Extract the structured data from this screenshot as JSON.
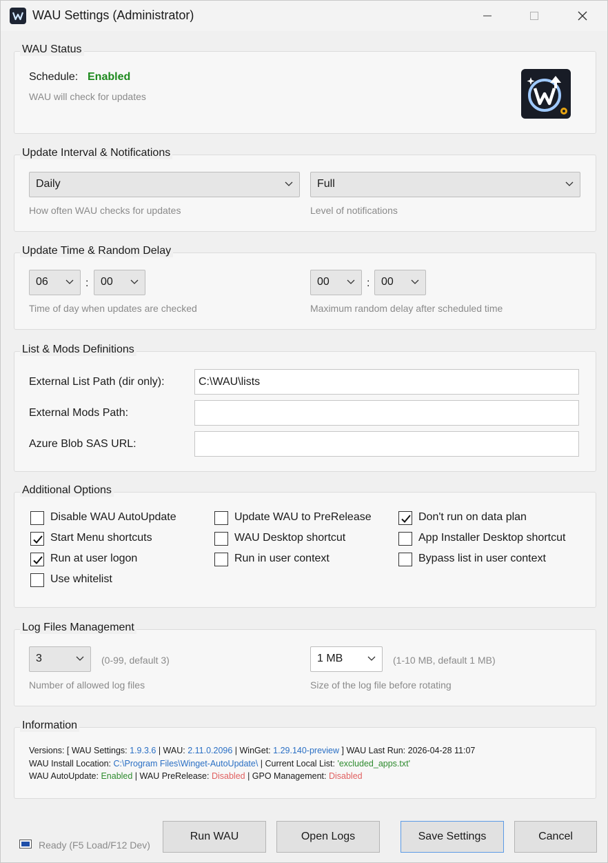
{
  "window": {
    "title": "WAU Settings (Administrator)"
  },
  "status": {
    "group_title": "WAU Status",
    "schedule_label": "Schedule:",
    "schedule_value": "Enabled",
    "description": "WAU will check for updates",
    "schedule_color": "#1e8a1e"
  },
  "interval": {
    "group_title": "Update Interval & Notifications",
    "frequency_value": "Daily",
    "frequency_hint": "How often WAU checks for updates",
    "notification_value": "Full",
    "notification_hint": "Level of notifications"
  },
  "time": {
    "group_title": "Update Time & Random Delay",
    "hour_value": "06",
    "minute_value": "00",
    "separator": ":",
    "time_hint": "Time of day when updates are checked",
    "delay_hour_value": "00",
    "delay_minute_value": "00",
    "delay_hint": "Maximum random delay after scheduled time"
  },
  "lists": {
    "group_title": "List & Mods Definitions",
    "external_list_label": "External List Path (dir only):",
    "external_list_value": "C:\\WAU\\lists",
    "external_mods_label": "External Mods Path:",
    "external_mods_value": "",
    "azure_label": "Azure Blob SAS URL:",
    "azure_value": ""
  },
  "options": {
    "group_title": "Additional Options",
    "items": [
      {
        "label": "Disable WAU AutoUpdate",
        "checked": false
      },
      {
        "label": "Update WAU to PreRelease",
        "checked": false
      },
      {
        "label": "Don't run on data plan",
        "checked": true
      },
      {
        "label": "Start Menu shortcuts",
        "checked": true
      },
      {
        "label": "WAU Desktop shortcut",
        "checked": false
      },
      {
        "label": "App Installer Desktop shortcut",
        "checked": false
      },
      {
        "label": "Run at user logon",
        "checked": true
      },
      {
        "label": "Run in user context",
        "checked": false
      },
      {
        "label": "Bypass list in user context",
        "checked": false
      },
      {
        "label": "Use whitelist",
        "checked": false
      }
    ]
  },
  "logs": {
    "group_title": "Log Files Management",
    "count_value": "3",
    "count_note": "(0-99, default 3)",
    "count_hint": "Number of allowed log files",
    "size_value": "1 MB",
    "size_note": "(1-10 MB, default 1 MB)",
    "size_hint": "Size of the log file before rotating"
  },
  "information": {
    "group_title": "Information",
    "line1": {
      "prefix": "Versions: [ WAU Settings: ",
      "settings_version": "1.9.3.6",
      "sep1": " | WAU: ",
      "wau_version": "2.11.0.2096",
      "sep2": " | WinGet: ",
      "winget_version": "1.29.140-preview",
      "suffix": " ] WAU Last Run: 2026-04-28 11:07"
    },
    "line2": {
      "prefix": "WAU Install Location: ",
      "install_location": "C:\\Program Files\\Winget-AutoUpdate\\",
      "sep": " | Current Local List: ",
      "local_list": "'excluded_apps.txt'"
    },
    "line3": {
      "autoupdate_label": "WAU AutoUpdate: ",
      "autoupdate_value": "Enabled",
      "prerelease_label": " | WAU PreRelease: ",
      "prerelease_value": "Disabled",
      "gpo_label": " | GPO Management: ",
      "gpo_value": "Disabled"
    }
  },
  "footer": {
    "status_text": "Ready (F5 Load/F12 Dev)",
    "run_label": "Run WAU",
    "logs_label": "Open Logs",
    "save_label": "Save Settings",
    "cancel_label": "Cancel"
  },
  "colors": {
    "link_blue": "#2a6fc4",
    "status_green": "#2e8b2e",
    "status_red": "#e06060",
    "primary_border": "#5a9ae6"
  }
}
